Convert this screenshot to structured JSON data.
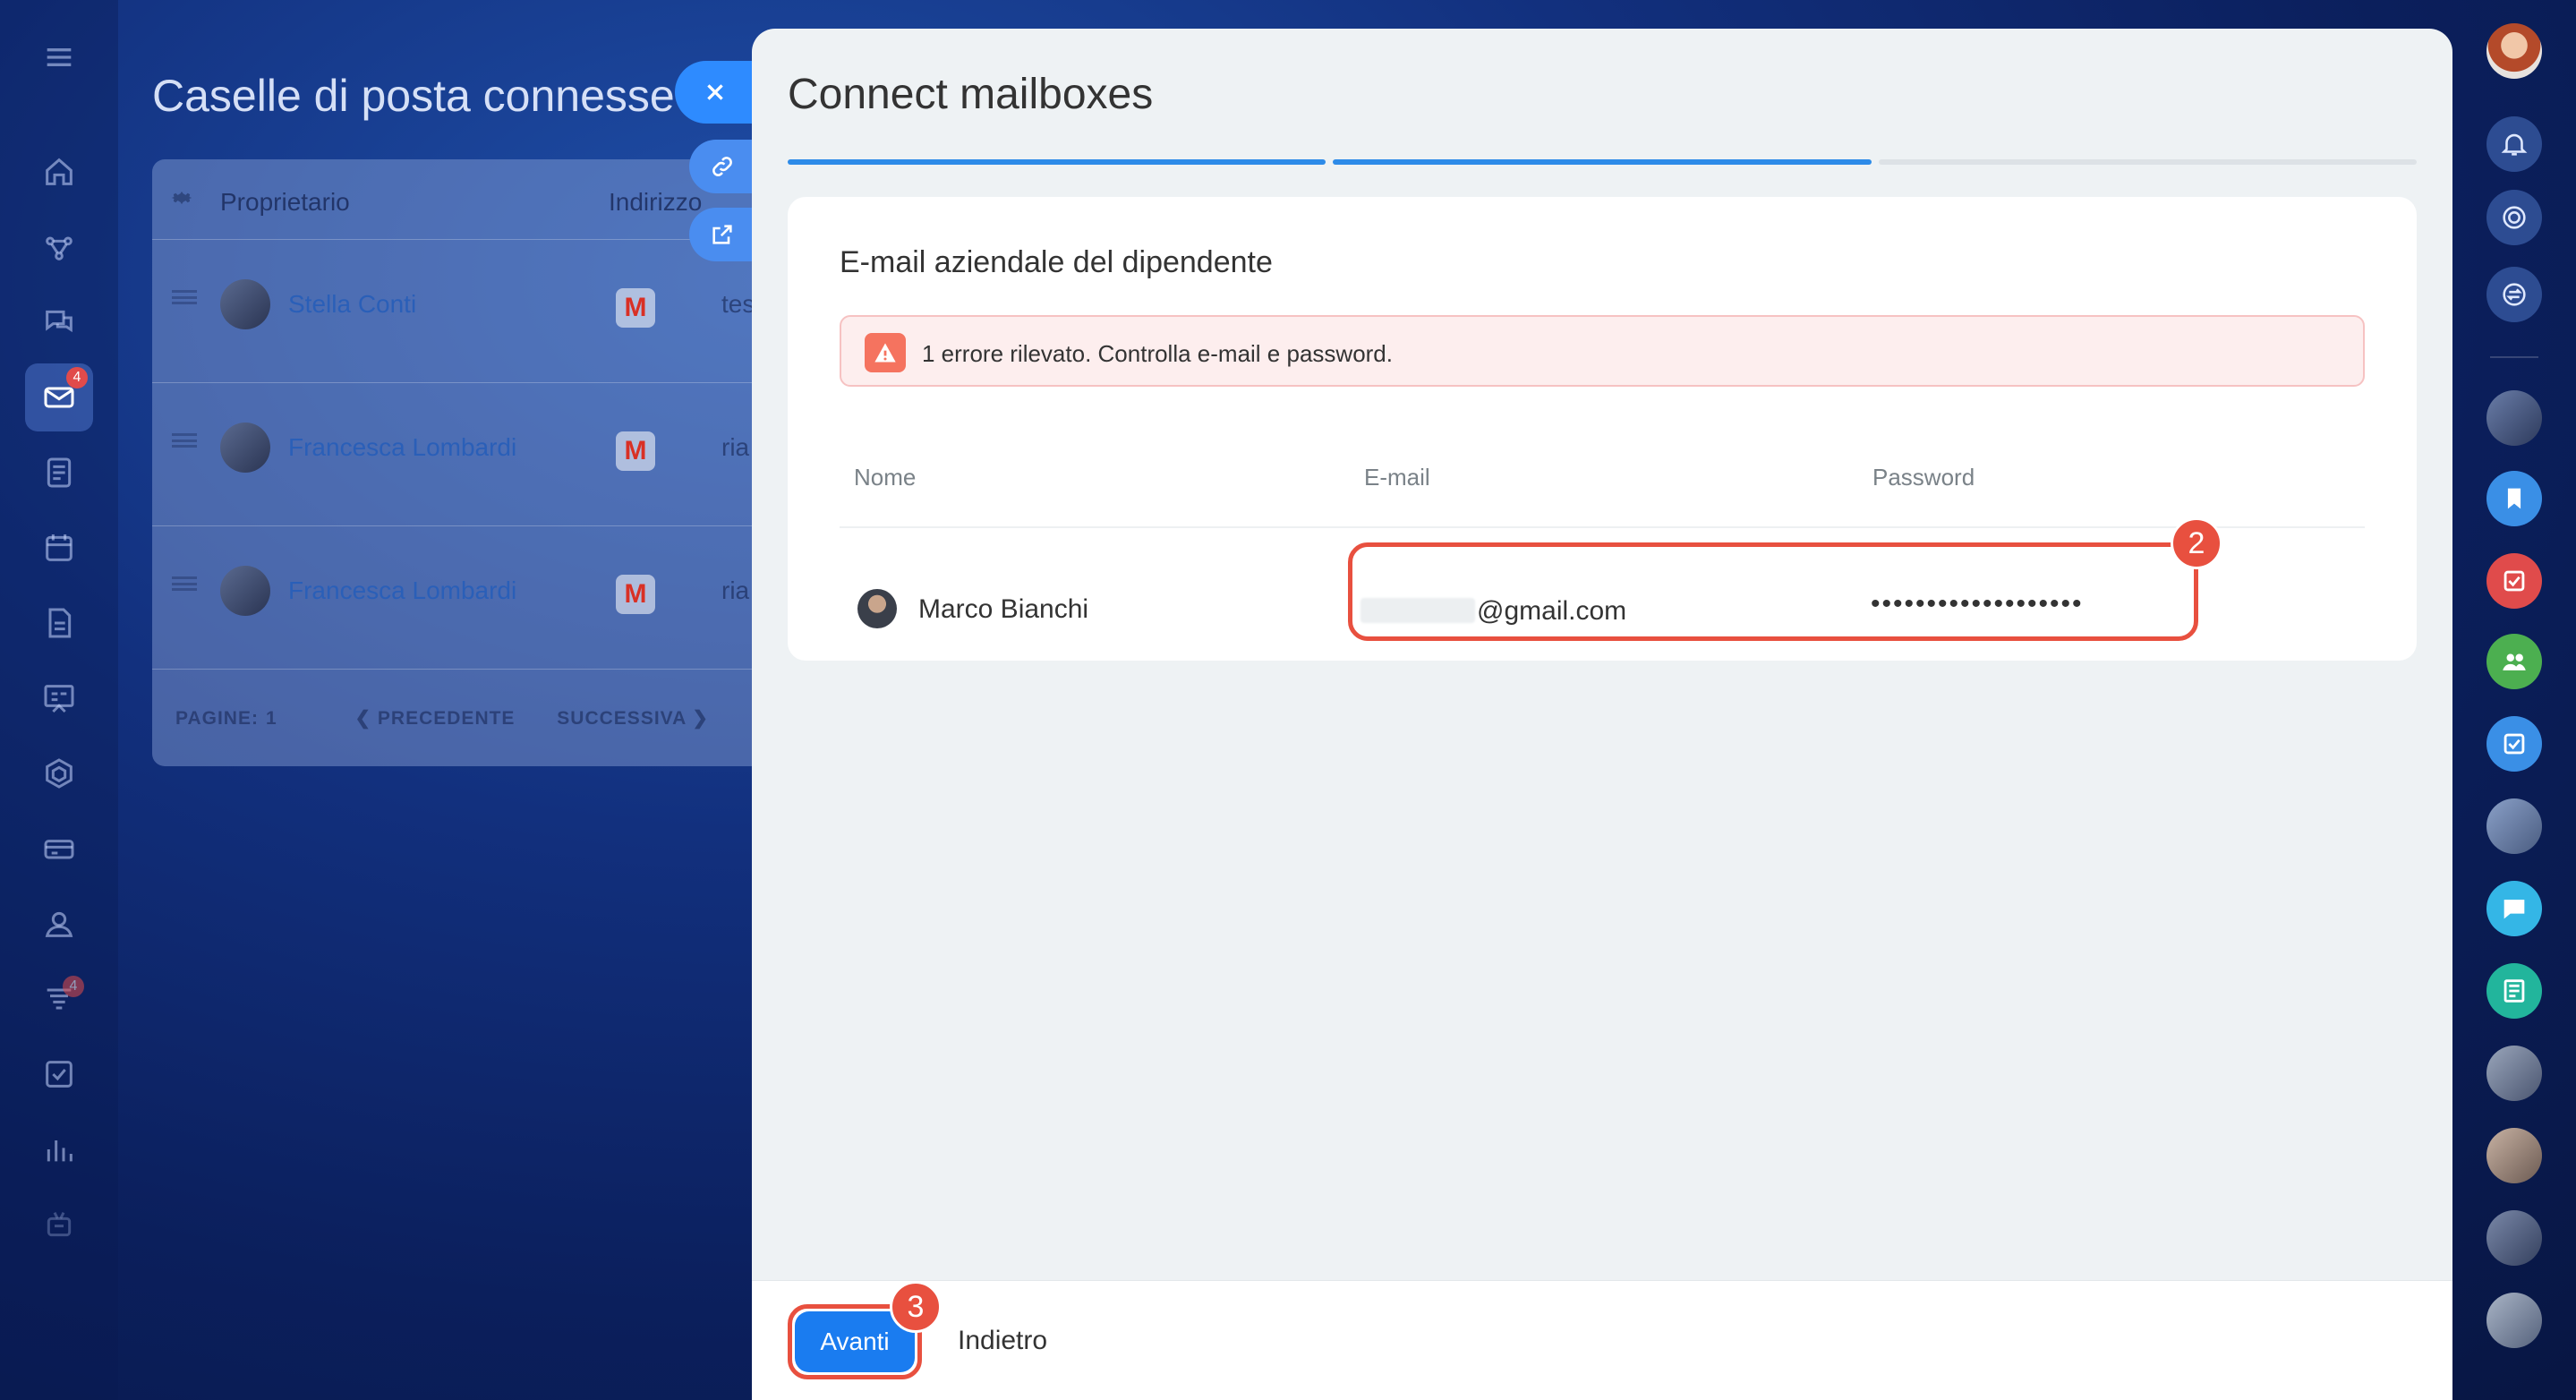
{
  "left_nav": {
    "icons": [
      "menu-icon",
      "home-icon",
      "crm-icon",
      "chat-icon",
      "mail-icon",
      "feed-icon",
      "calendar-icon",
      "docs-icon",
      "board-icon",
      "sites-icon",
      "store-icon",
      "users-icon",
      "funnel-icon",
      "tasks-icon",
      "reports-icon",
      "automation-icon"
    ],
    "mail_badge": "4",
    "funnel_badge": "4"
  },
  "background_page": {
    "title": "Caselle di posta connesse",
    "headers": {
      "owner": "Proprietario",
      "address": "Indirizzo"
    },
    "rows": [
      {
        "owner": "Stella Conti",
        "address": "tes"
      },
      {
        "owner": "Francesca Lombardi",
        "address": "ria"
      },
      {
        "owner": "Francesca Lombardi",
        "address": "ria"
      }
    ],
    "pager": {
      "pages_label": "PAGINE:",
      "page": "1",
      "prev": "❮ PRECEDENTE",
      "next": "SUCCESSIVA ❯"
    }
  },
  "panel": {
    "title": "Connect mailboxes",
    "progress": {
      "total_steps": 3,
      "completed_steps": 2
    },
    "card": {
      "title": "E-mail aziendale del dipendente",
      "alert_text": "1 errore rilevato. Controlla e-mail e password.",
      "columns": {
        "name": "Nome",
        "email": "E-mail",
        "password": "Password"
      },
      "row": {
        "name": "Marco Bianchi",
        "email": "@gmail.com",
        "password": "•••••••••••••••••••"
      },
      "highlight_step": "2"
    },
    "footer": {
      "next_label": "Avanti",
      "back_label": "Indietro",
      "next_step": "3"
    }
  },
  "colors": {
    "accent": "#1a7cf0",
    "highlight": "#e8503f",
    "alert_bg": "#fdeeee"
  }
}
